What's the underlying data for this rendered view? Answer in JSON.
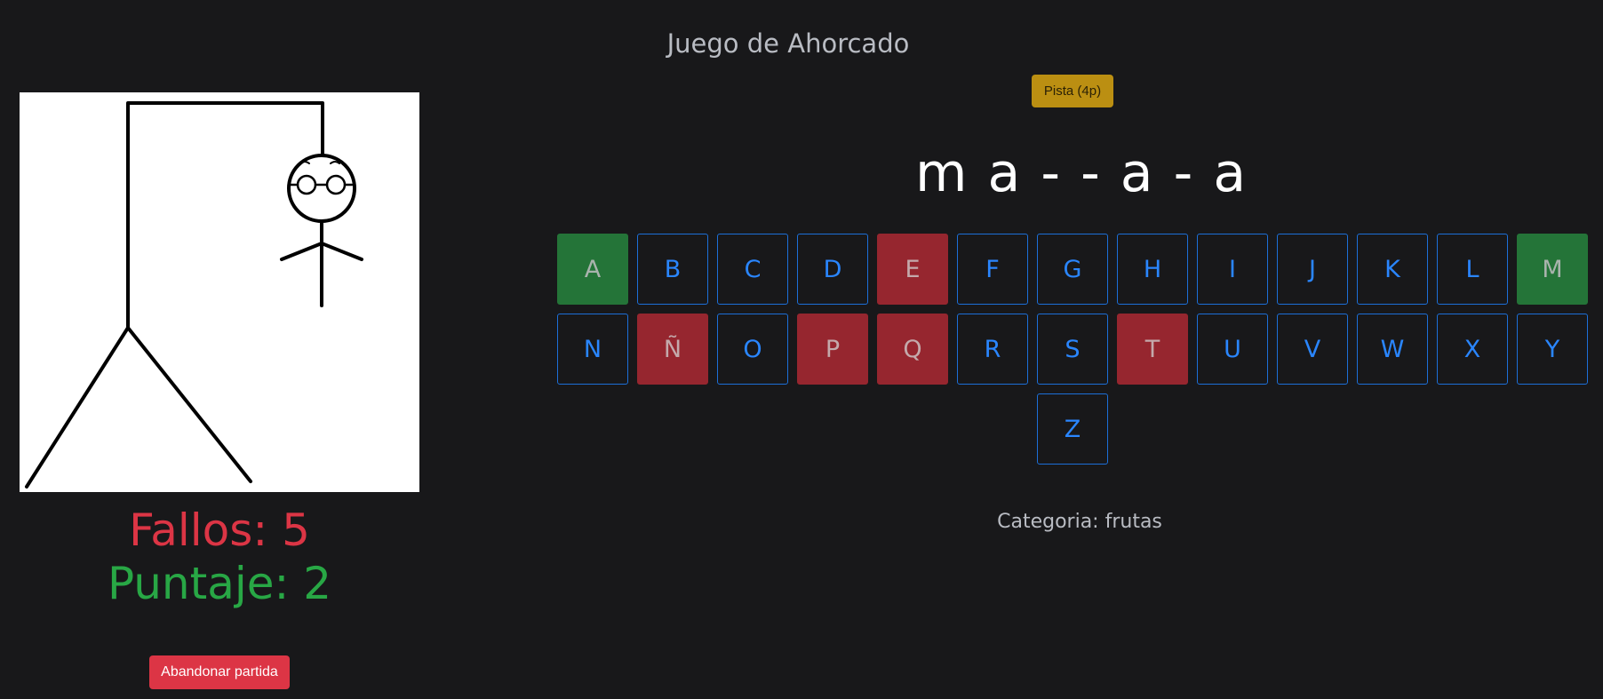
{
  "header": {
    "title": "Juego de Ahorcado"
  },
  "hint": {
    "label": "Pista (4p)"
  },
  "word": {
    "display": "m a - - a - a"
  },
  "keyboard": {
    "keys": [
      {
        "letter": "A",
        "state": "correct"
      },
      {
        "letter": "B",
        "state": "available"
      },
      {
        "letter": "C",
        "state": "available"
      },
      {
        "letter": "D",
        "state": "available"
      },
      {
        "letter": "E",
        "state": "wrong"
      },
      {
        "letter": "F",
        "state": "available"
      },
      {
        "letter": "G",
        "state": "available"
      },
      {
        "letter": "H",
        "state": "available"
      },
      {
        "letter": "I",
        "state": "available"
      },
      {
        "letter": "J",
        "state": "available"
      },
      {
        "letter": "K",
        "state": "available"
      },
      {
        "letter": "L",
        "state": "available"
      },
      {
        "letter": "M",
        "state": "correct"
      },
      {
        "letter": "N",
        "state": "available"
      },
      {
        "letter": "Ñ",
        "state": "wrong"
      },
      {
        "letter": "O",
        "state": "available"
      },
      {
        "letter": "P",
        "state": "wrong"
      },
      {
        "letter": "Q",
        "state": "wrong"
      },
      {
        "letter": "R",
        "state": "available"
      },
      {
        "letter": "S",
        "state": "available"
      },
      {
        "letter": "T",
        "state": "wrong"
      },
      {
        "letter": "U",
        "state": "available"
      },
      {
        "letter": "V",
        "state": "available"
      },
      {
        "letter": "W",
        "state": "available"
      },
      {
        "letter": "X",
        "state": "available"
      },
      {
        "letter": "Y",
        "state": "available"
      },
      {
        "letter": "Z",
        "state": "available"
      }
    ]
  },
  "category": {
    "text": "Categoria: frutas"
  },
  "stats": {
    "fallos_text": "Fallos: 5",
    "puntaje_text": "Puntaje: 2"
  },
  "actions": {
    "abandon_label": "Abandonar partida"
  },
  "colors": {
    "background": "#18181a",
    "key_border": "#1c6fd8",
    "key_text": "#2a86ff",
    "correct": "#247438",
    "wrong": "#96262f",
    "fallos": "#dc3545",
    "puntaje": "#28a745",
    "hint_button": "#bb8f12"
  }
}
